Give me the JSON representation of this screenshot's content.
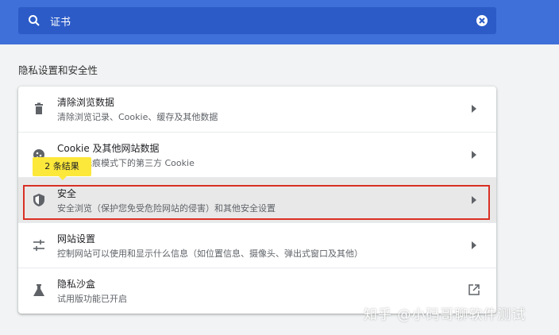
{
  "search": {
    "query": "证书"
  },
  "section": {
    "title": "隐私设置和安全性"
  },
  "items": [
    {
      "title": "清除浏览数据",
      "subtitle": "清除浏览记录、Cookie、缓存及其他数据"
    },
    {
      "title": "Cookie 及其他网站数据",
      "subtitle": "已阻止无痕模式下的第三方 Cookie"
    },
    {
      "title": "安全",
      "subtitle": "安全浏览（保护您免受危险网站的侵害）和其他安全设置"
    },
    {
      "title": "网站设置",
      "subtitle": "控制网站可以使用和显示什么信息（如位置信息、摄像头、弹出式窗口及其他）"
    },
    {
      "title": "隐私沙盒",
      "subtitle": "试用版功能已开启"
    }
  ],
  "tooltip": {
    "text": "2 条结果"
  },
  "watermark": {
    "text": "知乎 @小码哥聊软件测试"
  },
  "colors": {
    "header": "#3f6fd8",
    "search_bg": "#2c5bc7",
    "highlight_border": "#d93025",
    "tooltip_bg": "#fce83a"
  }
}
